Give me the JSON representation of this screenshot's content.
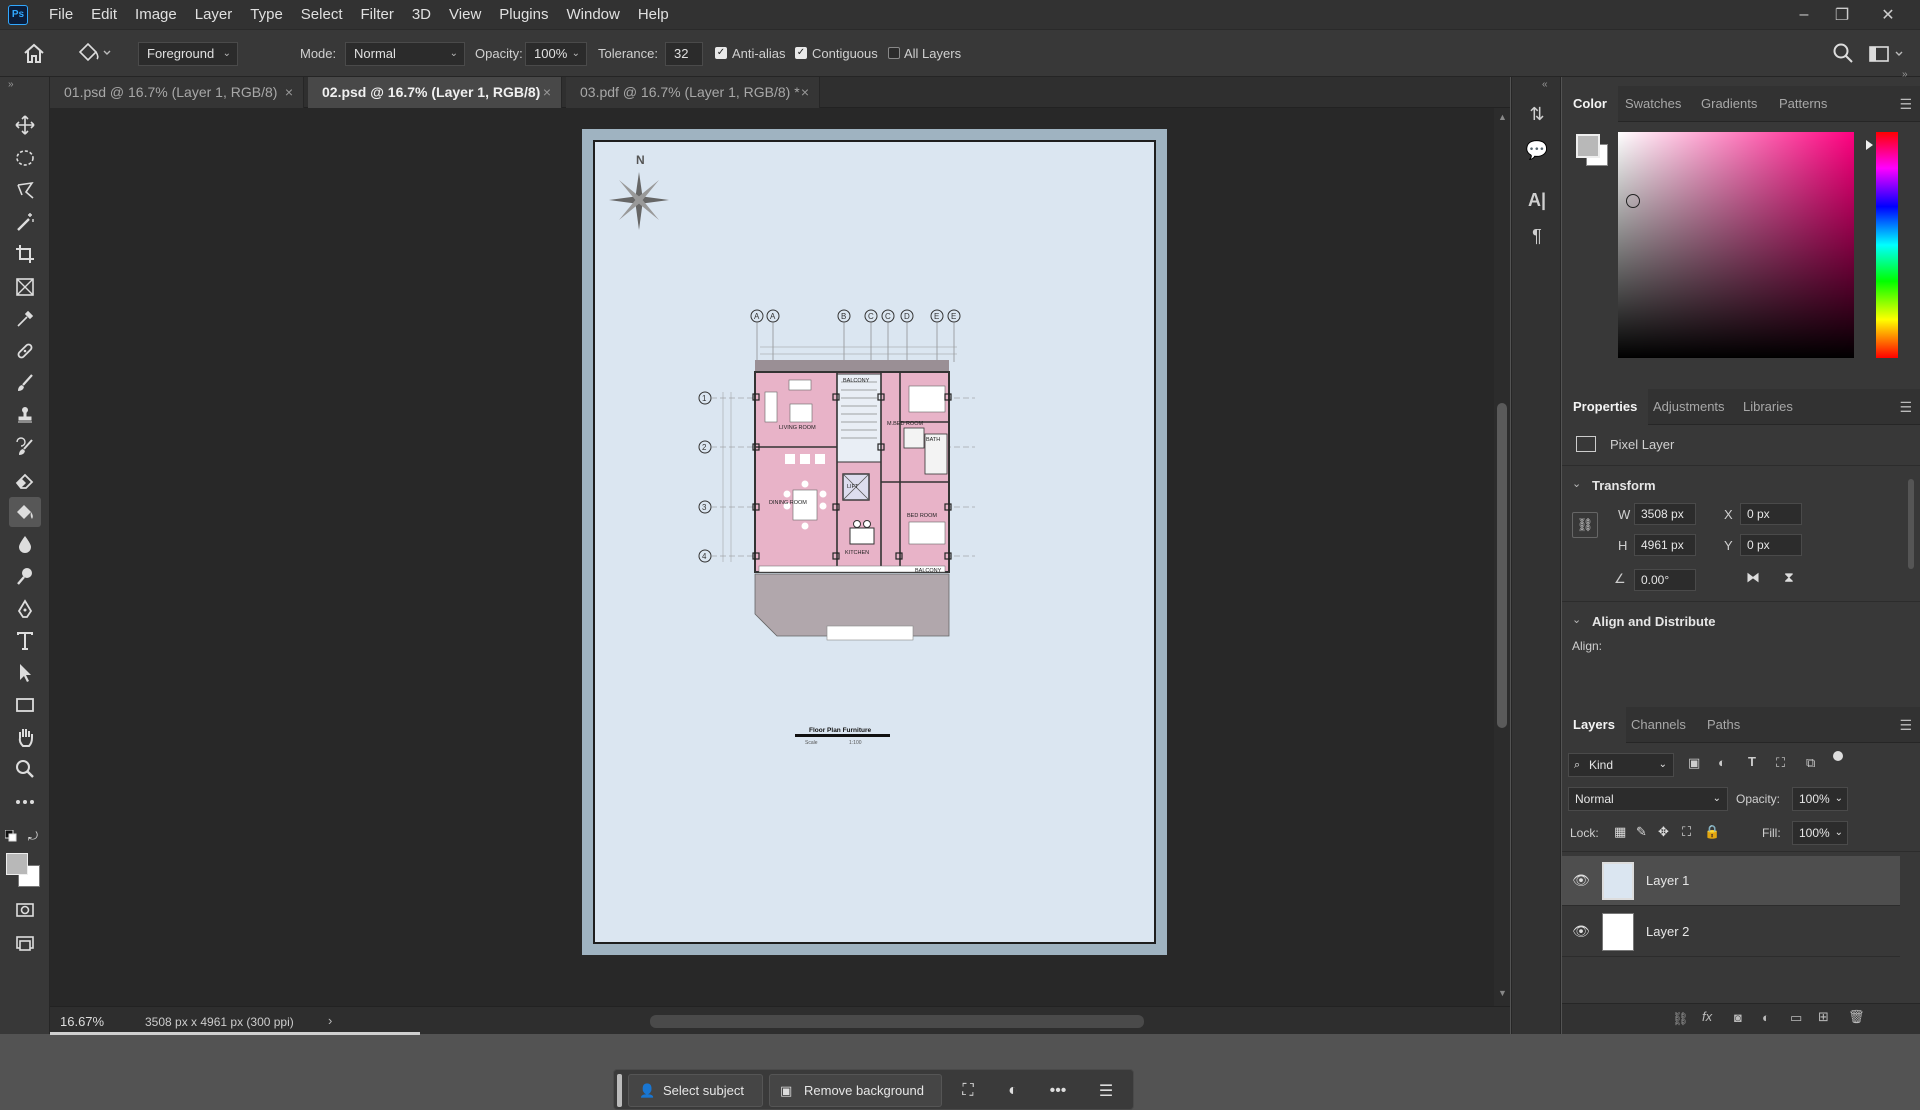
{
  "app": {
    "logo": "Ps"
  },
  "menu": [
    "File",
    "Edit",
    "Image",
    "Layer",
    "Type",
    "Select",
    "Filter",
    "3D",
    "View",
    "Plugins",
    "Window",
    "Help"
  ],
  "options": {
    "fill_source": "Foreground",
    "mode_label": "Mode:",
    "mode_value": "Normal",
    "opacity_label": "Opacity:",
    "opacity_value": "100%",
    "tolerance_label": "Tolerance:",
    "tolerance_value": "32",
    "anti_alias": "Anti-alias",
    "contiguous": "Contiguous",
    "all_layers": "All Layers"
  },
  "tabs": [
    {
      "label": "01.psd @ 16.7% (Layer 1, RGB/8)"
    },
    {
      "label": "02.psd @ 16.7% (Layer 1, RGB/8)"
    },
    {
      "label": "03.pdf @ 16.7% (Layer 1, RGB/8) *"
    }
  ],
  "tab_close": "×",
  "status": {
    "zoom": "16.67%",
    "doc_size": "3508 px x 4961 px (300 ppi)",
    "arrow": "›"
  },
  "context_bar": {
    "select_subject": "Select subject",
    "remove_background": "Remove background"
  },
  "drawing": {
    "north": "N",
    "grid_cols": [
      "A",
      "A",
      "B",
      "C",
      "C",
      "D",
      "E",
      "E"
    ],
    "grid_rows": [
      "1",
      "2",
      "3",
      "4"
    ],
    "rooms": {
      "balcony_top": "BALCONY",
      "living": "LIVING ROOM",
      "m_bed": "M.BED ROOM",
      "bath": "BATH",
      "dining": "DINING ROOM",
      "lift": "LIFT",
      "bed": "BED ROOM",
      "kitchen": "KITCHEN",
      "balcony_bottom": "BALCONY"
    },
    "title": "Floor Plan Furniture",
    "scale_label": "Scale",
    "scale_value": "1:100"
  },
  "color_panel": {
    "tabs": [
      "Color",
      "Swatches",
      "Gradients",
      "Patterns"
    ]
  },
  "properties_panel": {
    "tabs": [
      "Properties",
      "Adjustments",
      "Libraries"
    ],
    "layer_type": "Pixel Layer",
    "transform_title": "Transform",
    "w_label": "W",
    "w_value": "3508 px",
    "h_label": "H",
    "h_value": "4961 px",
    "x_label": "X",
    "x_value": "0 px",
    "y_label": "Y",
    "y_value": "0 px",
    "angle_value": "0.00°",
    "align_title": "Align and Distribute",
    "align_label": "Align:"
  },
  "layers_panel": {
    "tabs": [
      "Layers",
      "Channels",
      "Paths"
    ],
    "filter_kind": "Kind",
    "blend_mode": "Normal",
    "opacity_label": "Opacity:",
    "opacity_value": "100%",
    "lock_label": "Lock:",
    "fill_label": "Fill:",
    "fill_value": "100%",
    "layers": [
      {
        "name": "Layer 1"
      },
      {
        "name": "Layer 2"
      }
    ]
  },
  "colors": {
    "accent": "#31a8ff",
    "canvas_bg": "#dbe6f1",
    "plan_pink": "#e8b3c8"
  }
}
